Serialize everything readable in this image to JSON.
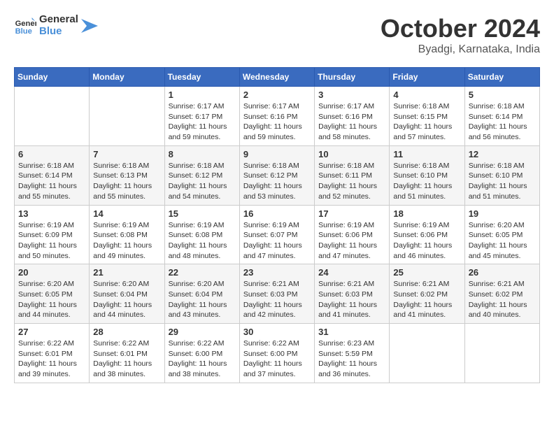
{
  "header": {
    "logo_general": "General",
    "logo_blue": "Blue",
    "month_title": "October 2024",
    "location": "Byadgi, Karnataka, India"
  },
  "calendar": {
    "headers": [
      "Sunday",
      "Monday",
      "Tuesday",
      "Wednesday",
      "Thursday",
      "Friday",
      "Saturday"
    ],
    "weeks": [
      [
        {
          "day": "",
          "detail": ""
        },
        {
          "day": "",
          "detail": ""
        },
        {
          "day": "1",
          "detail": "Sunrise: 6:17 AM\nSunset: 6:17 PM\nDaylight: 11 hours and 59 minutes."
        },
        {
          "day": "2",
          "detail": "Sunrise: 6:17 AM\nSunset: 6:16 PM\nDaylight: 11 hours and 59 minutes."
        },
        {
          "day": "3",
          "detail": "Sunrise: 6:17 AM\nSunset: 6:16 PM\nDaylight: 11 hours and 58 minutes."
        },
        {
          "day": "4",
          "detail": "Sunrise: 6:18 AM\nSunset: 6:15 PM\nDaylight: 11 hours and 57 minutes."
        },
        {
          "day": "5",
          "detail": "Sunrise: 6:18 AM\nSunset: 6:14 PM\nDaylight: 11 hours and 56 minutes."
        }
      ],
      [
        {
          "day": "6",
          "detail": "Sunrise: 6:18 AM\nSunset: 6:14 PM\nDaylight: 11 hours and 55 minutes."
        },
        {
          "day": "7",
          "detail": "Sunrise: 6:18 AM\nSunset: 6:13 PM\nDaylight: 11 hours and 55 minutes."
        },
        {
          "day": "8",
          "detail": "Sunrise: 6:18 AM\nSunset: 6:12 PM\nDaylight: 11 hours and 54 minutes."
        },
        {
          "day": "9",
          "detail": "Sunrise: 6:18 AM\nSunset: 6:12 PM\nDaylight: 11 hours and 53 minutes."
        },
        {
          "day": "10",
          "detail": "Sunrise: 6:18 AM\nSunset: 6:11 PM\nDaylight: 11 hours and 52 minutes."
        },
        {
          "day": "11",
          "detail": "Sunrise: 6:18 AM\nSunset: 6:10 PM\nDaylight: 11 hours and 51 minutes."
        },
        {
          "day": "12",
          "detail": "Sunrise: 6:18 AM\nSunset: 6:10 PM\nDaylight: 11 hours and 51 minutes."
        }
      ],
      [
        {
          "day": "13",
          "detail": "Sunrise: 6:19 AM\nSunset: 6:09 PM\nDaylight: 11 hours and 50 minutes."
        },
        {
          "day": "14",
          "detail": "Sunrise: 6:19 AM\nSunset: 6:08 PM\nDaylight: 11 hours and 49 minutes."
        },
        {
          "day": "15",
          "detail": "Sunrise: 6:19 AM\nSunset: 6:08 PM\nDaylight: 11 hours and 48 minutes."
        },
        {
          "day": "16",
          "detail": "Sunrise: 6:19 AM\nSunset: 6:07 PM\nDaylight: 11 hours and 47 minutes."
        },
        {
          "day": "17",
          "detail": "Sunrise: 6:19 AM\nSunset: 6:06 PM\nDaylight: 11 hours and 47 minutes."
        },
        {
          "day": "18",
          "detail": "Sunrise: 6:19 AM\nSunset: 6:06 PM\nDaylight: 11 hours and 46 minutes."
        },
        {
          "day": "19",
          "detail": "Sunrise: 6:20 AM\nSunset: 6:05 PM\nDaylight: 11 hours and 45 minutes."
        }
      ],
      [
        {
          "day": "20",
          "detail": "Sunrise: 6:20 AM\nSunset: 6:05 PM\nDaylight: 11 hours and 44 minutes."
        },
        {
          "day": "21",
          "detail": "Sunrise: 6:20 AM\nSunset: 6:04 PM\nDaylight: 11 hours and 44 minutes."
        },
        {
          "day": "22",
          "detail": "Sunrise: 6:20 AM\nSunset: 6:04 PM\nDaylight: 11 hours and 43 minutes."
        },
        {
          "day": "23",
          "detail": "Sunrise: 6:21 AM\nSunset: 6:03 PM\nDaylight: 11 hours and 42 minutes."
        },
        {
          "day": "24",
          "detail": "Sunrise: 6:21 AM\nSunset: 6:03 PM\nDaylight: 11 hours and 41 minutes."
        },
        {
          "day": "25",
          "detail": "Sunrise: 6:21 AM\nSunset: 6:02 PM\nDaylight: 11 hours and 41 minutes."
        },
        {
          "day": "26",
          "detail": "Sunrise: 6:21 AM\nSunset: 6:02 PM\nDaylight: 11 hours and 40 minutes."
        }
      ],
      [
        {
          "day": "27",
          "detail": "Sunrise: 6:22 AM\nSunset: 6:01 PM\nDaylight: 11 hours and 39 minutes."
        },
        {
          "day": "28",
          "detail": "Sunrise: 6:22 AM\nSunset: 6:01 PM\nDaylight: 11 hours and 38 minutes."
        },
        {
          "day": "29",
          "detail": "Sunrise: 6:22 AM\nSunset: 6:00 PM\nDaylight: 11 hours and 38 minutes."
        },
        {
          "day": "30",
          "detail": "Sunrise: 6:22 AM\nSunset: 6:00 PM\nDaylight: 11 hours and 37 minutes."
        },
        {
          "day": "31",
          "detail": "Sunrise: 6:23 AM\nSunset: 5:59 PM\nDaylight: 11 hours and 36 minutes."
        },
        {
          "day": "",
          "detail": ""
        },
        {
          "day": "",
          "detail": ""
        }
      ]
    ]
  }
}
